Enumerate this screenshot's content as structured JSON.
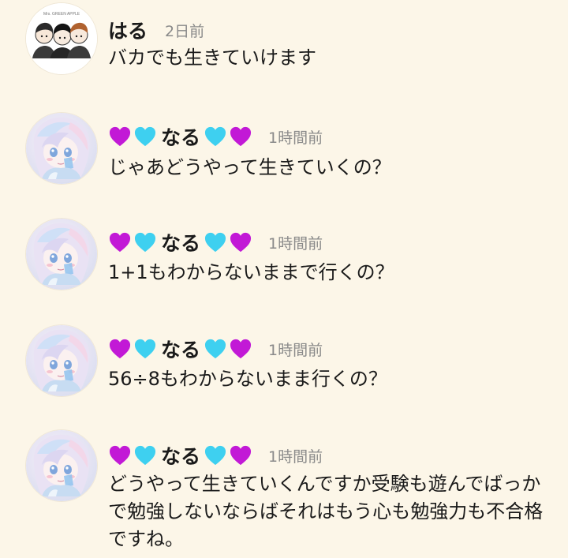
{
  "comments": [
    {
      "username": "はる",
      "time": "2日前",
      "text": "バカでも生きていけます",
      "avatar": "three-characters-avatar"
    },
    {
      "username": "なる",
      "time": "1時間前",
      "text": "じゃあどうやって生きていくの？",
      "avatar": "pastel-anime-girl-avatar",
      "name_emoji": [
        "purple-heart",
        "light-blue-heart",
        "light-blue-heart",
        "purple-heart"
      ]
    },
    {
      "username": "なる",
      "time": "1時間前",
      "text": "1+1もわからないままで行くの？",
      "avatar": "pastel-anime-girl-avatar",
      "name_emoji": [
        "purple-heart",
        "light-blue-heart",
        "light-blue-heart",
        "purple-heart"
      ]
    },
    {
      "username": "なる",
      "time": "1時間前",
      "text": "56÷8もわからないまま行くの？",
      "avatar": "pastel-anime-girl-avatar",
      "name_emoji": [
        "purple-heart",
        "light-blue-heart",
        "light-blue-heart",
        "purple-heart"
      ]
    },
    {
      "username": "なる",
      "time": "1時間前",
      "text": "どうやって生きていくんですか受験も遊んでばっかで勉強しないならばそれはもう心も勉強力も不合格ですね。",
      "avatar": "pastel-anime-girl-avatar",
      "name_emoji": [
        "purple-heart",
        "light-blue-heart",
        "light-blue-heart",
        "purple-heart"
      ]
    }
  ],
  "colors": {
    "background": "#fcf6e8",
    "purple_heart": "#c219d6",
    "blue_heart": "#3ed0f0",
    "timestamp": "#8a8a8a",
    "text": "#1a1a1a"
  }
}
